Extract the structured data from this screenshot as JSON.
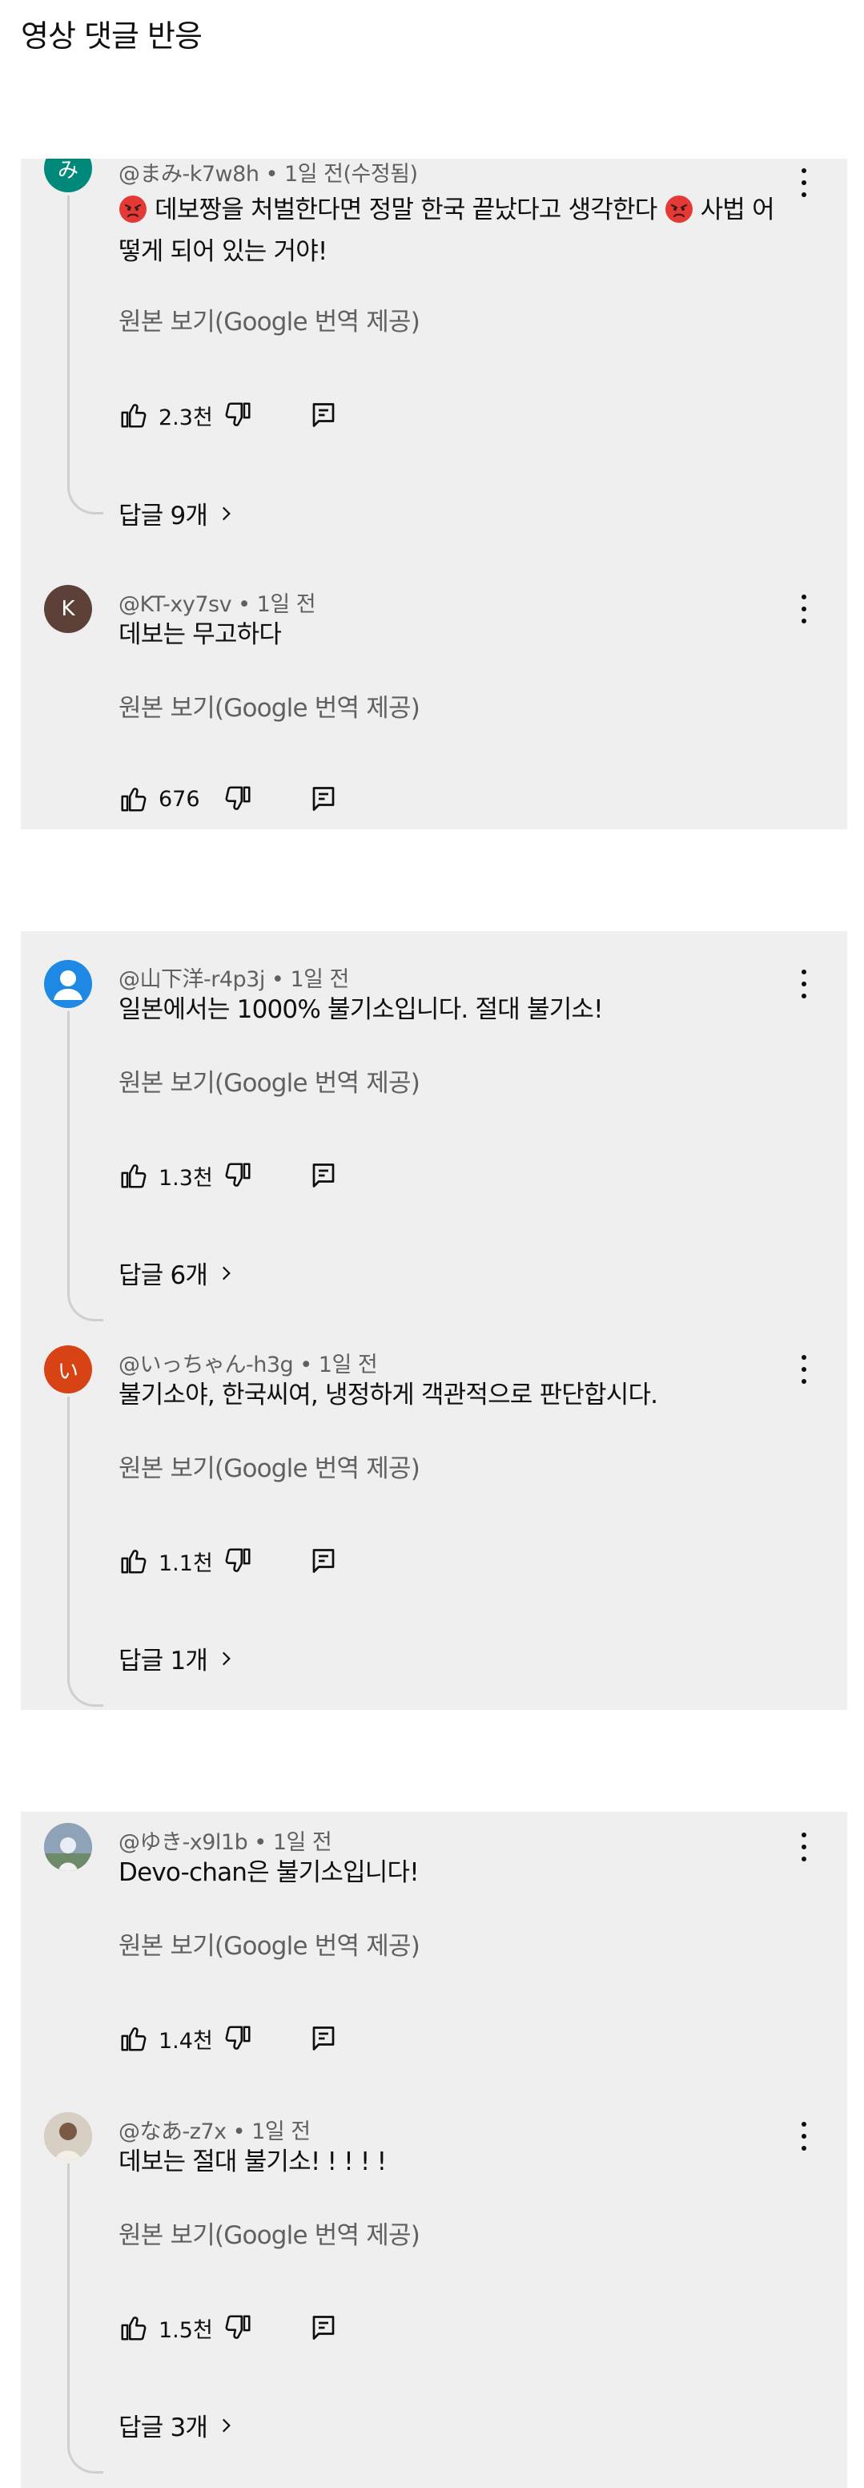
{
  "page": {
    "title": "영상 댓글 반응"
  },
  "translate_label": "원본 보기(Google 번역 제공)",
  "comments": {
    "c1": {
      "avatar_letter": "み",
      "avatar_color": "#00897b",
      "author": "@まみ-k7w8h",
      "time": "1일 전(수정됨)",
      "text_a": "데보짱을 처벌한다면 정말 한국 끝났다고 생각한다",
      "text_b": "사법 어떻게 되어 있는 거야!",
      "likes": "2.3천",
      "replies": "답글 9개"
    },
    "c2": {
      "avatar_letter": "K",
      "avatar_color": "#5d4037",
      "author": "@KT-xy7sv",
      "time": "1일 전",
      "text": "데보는 무고하다",
      "likes": "676"
    },
    "c3": {
      "avatar_letter": "",
      "avatar_color": "#1e88e5",
      "author": "@山下洋-r4p3j",
      "time": "1일 전",
      "text": "일본에서는 1000% 불기소입니다. 절대 불기소!",
      "likes": "1.3천",
      "replies": "답글 6개"
    },
    "c4": {
      "avatar_letter": "い",
      "avatar_color": "#d84315",
      "author": "@いっちゃん-h3g",
      "time": "1일 전",
      "text": "불기소야, 한국씨여, 냉정하게 객관적으로 판단합시다.",
      "likes": "1.1천",
      "replies": "답글 1개"
    },
    "c5": {
      "avatar_letter": "",
      "avatar_color": "#90a4ae",
      "author": "@ゆき-x9l1b",
      "time": "1일 전",
      "text": "Devo-chan은 불기소입니다!",
      "likes": "1.4천"
    },
    "c6": {
      "avatar_letter": "",
      "avatar_color": "#bcaaa4",
      "author": "@なあ-z7x",
      "time": "1일 전",
      "text": "데보는 절대 불기소! ! ! ! !",
      "likes": "1.5천",
      "replies": "답글 3개"
    }
  },
  "icons": {
    "like": "thumbs-up-icon",
    "dislike": "thumbs-down-icon",
    "reply": "reply-comment-icon",
    "more": "more-vertical-icon",
    "angry": "angry-face-emoji",
    "chevron": "chevron-right-icon"
  }
}
